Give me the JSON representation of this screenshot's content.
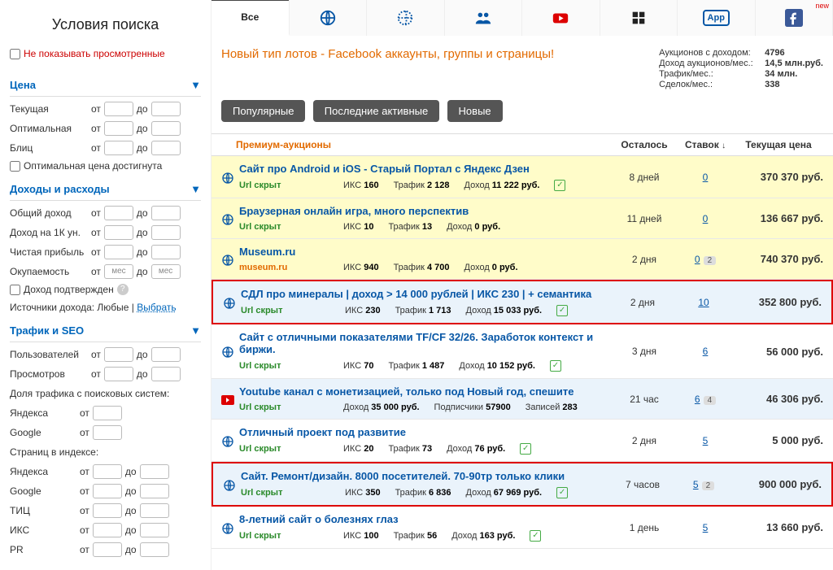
{
  "sidebar": {
    "title": "Условия поиска",
    "hide_viewed": "Не показывать просмотренные",
    "sections": {
      "price": {
        "title": "Цена",
        "rows": [
          {
            "label": "Текущая",
            "from": "от",
            "to": "до"
          },
          {
            "label": "Оптимальная",
            "from": "от",
            "to": "до"
          },
          {
            "label": "Блиц",
            "from": "от",
            "to": "до"
          }
        ],
        "opt_price_reached": "Оптимальная цена достигнута"
      },
      "income": {
        "title": "Доходы и расходы",
        "rows": [
          {
            "label": "Общий доход",
            "from": "от",
            "to": "до"
          },
          {
            "label": "Доход на 1К ун.",
            "from": "от",
            "to": "до"
          },
          {
            "label": "Чистая прибыль",
            "from": "от",
            "to": "до"
          },
          {
            "label": "Окупаемость",
            "from": "от",
            "to": "до",
            "unit": "мес"
          }
        ],
        "income_confirmed": "Доход подтвержден",
        "sources_label": "Источники дохода: Любые | ",
        "sources_link": "Выбрать"
      },
      "traffic": {
        "title": "Трафик и SEO",
        "rows": [
          {
            "label": "Пользователей",
            "from": "от",
            "to": "до"
          },
          {
            "label": "Просмотров",
            "from": "от",
            "to": "до"
          }
        ],
        "search_share": "Доля трафика с поисковых систем:",
        "share_rows": [
          {
            "label": "Яндекса",
            "from": "от"
          },
          {
            "label": "Google",
            "from": "от"
          }
        ],
        "index_pages": "Страниц в индексе:",
        "index_rows": [
          {
            "label": "Яндекса",
            "from": "от",
            "to": "до"
          },
          {
            "label": "Google",
            "from": "от",
            "to": "до"
          },
          {
            "label": "ТИЦ",
            "from": "от",
            "to": "до"
          },
          {
            "label": "ИКС",
            "from": "от",
            "to": "до"
          },
          {
            "label": "PR",
            "from": "от",
            "to": "до"
          }
        ]
      }
    }
  },
  "topnav": {
    "all": "Все",
    "new": "new"
  },
  "banner": {
    "title": "Новый тип лотов - Facebook аккаунты, группы и страницы!"
  },
  "stats": {
    "auctions_income_k": "Аукционов с доходом:",
    "auctions_income_v": "4796",
    "monthly_income_k": "Доход аукционов/мес.:",
    "monthly_income_v": "14,5 млн.руб.",
    "traffic_k": "Трафик/мес.:",
    "traffic_v": "34 млн.",
    "deals_k": "Сделок/мес.:",
    "deals_v": "338"
  },
  "pills": {
    "popular": "Популярные",
    "recent": "Последние активные",
    "new": "Новые"
  },
  "table": {
    "premium": "Премиум-аукционы",
    "time": "Осталось",
    "bids": "Ставок",
    "price": "Текущая цена"
  },
  "lots": [
    {
      "type": "globe",
      "bg": "yellow",
      "title": "Сайт про Android и iOS - Старый Портал с Яндекс Дзен",
      "url": "Url скрыт",
      "iks_l": "ИКС",
      "iks": "160",
      "traf_l": "Трафик",
      "traf": "2 128",
      "inc_l": "Доход",
      "inc": "11 222 руб.",
      "chk": true,
      "time": "8 дней",
      "bids": "0",
      "price": "370 370 руб."
    },
    {
      "type": "globe",
      "bg": "yellow",
      "title": "Браузерная онлайн игра, много перспектив",
      "url": "Url скрыт",
      "iks_l": "ИКС",
      "iks": "10",
      "traf_l": "Трафик",
      "traf": "13",
      "inc_l": "Доход",
      "inc": "0 руб.",
      "time": "11 дней",
      "bids": "0",
      "price": "136 667 руб."
    },
    {
      "type": "globe",
      "bg": "yellow",
      "title": "Museum.ru",
      "dom": "museum.ru",
      "iks_l": "ИКС",
      "iks": "940",
      "traf_l": "Трафик",
      "traf": "4 700",
      "inc_l": "Доход",
      "inc": "0 руб.",
      "time": "2 дня",
      "bids": "0",
      "badge": "2",
      "price": "740 370 руб."
    },
    {
      "type": "globe",
      "bg": "blue",
      "red": true,
      "title": "СДЛ про минералы | доход > 14 000 рублей | ИКС 230 | + семантика",
      "url": "Url скрыт",
      "iks_l": "ИКС",
      "iks": "230",
      "traf_l": "Трафик",
      "traf": "1 713",
      "inc_l": "Доход",
      "inc": "15 033 руб.",
      "chk": true,
      "time": "2 дня",
      "bids": "10",
      "price": "352 800 руб."
    },
    {
      "type": "globe",
      "title": "Сайт с отличными показателями TF/CF 32/26. Заработок контекст и биржи.",
      "url": "Url скрыт",
      "iks_l": "ИКС",
      "iks": "70",
      "traf_l": "Трафик",
      "traf": "1 487",
      "inc_l": "Доход",
      "inc": "10 152 руб.",
      "chk": true,
      "time": "3 дня",
      "bids": "6",
      "price": "56 000 руб."
    },
    {
      "type": "yt",
      "bg": "blue",
      "title": "Youtube канал с монетизацией, только под Новый год, спешите",
      "url": "Url скрыт",
      "inc_l": "Доход",
      "inc": "35 000 руб.",
      "subs_l": "Подписчики",
      "subs": "57900",
      "rec_l": "Записей",
      "rec": "283",
      "time": "21 час",
      "bids": "6",
      "badge": "4",
      "price": "46 306 руб."
    },
    {
      "type": "globe",
      "title": "Отличный проект под развитие",
      "url": "Url скрыт",
      "iks_l": "ИКС",
      "iks": "20",
      "traf_l": "Трафик",
      "traf": "73",
      "inc_l": "Доход",
      "inc": "76 руб.",
      "chk": true,
      "time": "2 дня",
      "bids": "5",
      "price": "5 000 руб."
    },
    {
      "type": "globe",
      "bg": "blue",
      "red": true,
      "title": "Сайт. Ремонт/дизайн. 8000 посетителей. 70-90тр только клики",
      "url": "Url скрыт",
      "iks_l": "ИКС",
      "iks": "350",
      "traf_l": "Трафик",
      "traf": "6 836",
      "inc_l": "Доход",
      "inc": "67 969 руб.",
      "chk": true,
      "time": "7 часов",
      "bids": "5",
      "badge": "2",
      "price": "900 000 руб."
    },
    {
      "type": "globe",
      "title": "8-летний сайт о болезнях глаз",
      "url": "Url скрыт",
      "iks_l": "ИКС",
      "iks": "100",
      "traf_l": "Трафик",
      "traf": "56",
      "inc_l": "Доход",
      "inc": "163 руб.",
      "chk": true,
      "time": "1 день",
      "bids": "5",
      "price": "13 660 руб."
    }
  ]
}
